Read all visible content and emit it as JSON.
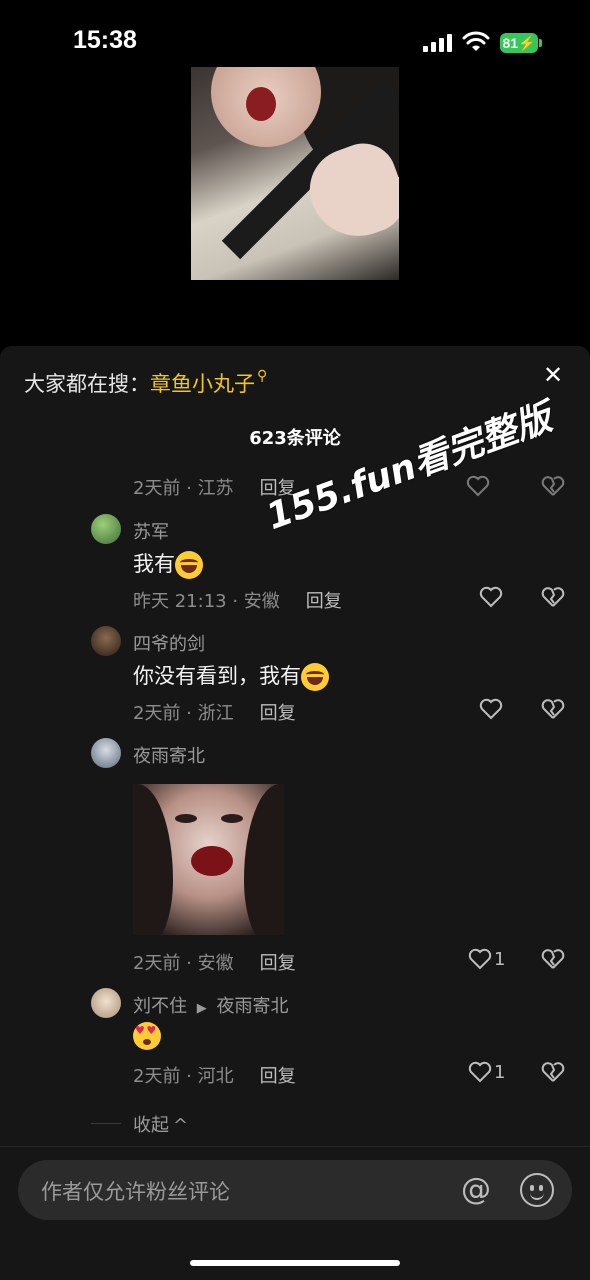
{
  "status": {
    "time": "15:38",
    "battery": "81"
  },
  "search": {
    "prefix": "大家都在搜：",
    "keyword": "章鱼小丸子"
  },
  "comments_header": {
    "count_label": "623条评论"
  },
  "comments": [
    {
      "meta": "2天前 · 江苏",
      "reply": "回复"
    },
    {
      "name": "苏军",
      "text": "我有",
      "emoji": "laugh",
      "meta": "昨天 21:13 · 安徽",
      "reply": "回复"
    },
    {
      "name": "四爷的剑",
      "text": "你没有看到，我有",
      "emoji": "laugh",
      "meta": "2天前 · 浙江",
      "reply": "回复"
    },
    {
      "name": "夜雨寄北",
      "meta": "2天前 · 安徽",
      "reply": "回复",
      "likes": "1"
    },
    {
      "name": "刘不住",
      "reply_arrow": "▶",
      "reply_to": "夜雨寄北",
      "emoji": "love",
      "meta": "2天前 · 河北",
      "reply": "回复",
      "likes": "1"
    }
  ],
  "collapse": {
    "label": "收起",
    "chevron": "^"
  },
  "input": {
    "placeholder": "作者仅允许粉丝评论",
    "at_symbol": "@"
  },
  "watermark": {
    "text": "155.fun看完整版"
  },
  "icons": {
    "close": "close-icon",
    "search": "search-icon",
    "heart": "heart-icon",
    "broken_heart": "broken-heart-icon",
    "at": "at-icon",
    "emoji": "emoji-icon"
  },
  "colors": {
    "accent_keyword": "#f5c518",
    "battery": "#34c759",
    "sheet_bg": "#161616"
  }
}
